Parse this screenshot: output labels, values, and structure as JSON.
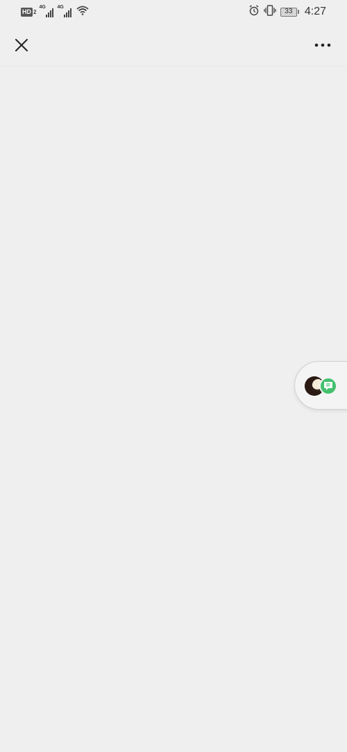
{
  "status_bar": {
    "hd_label": "HD",
    "hd_sub": "2",
    "network_1": "4G",
    "network_2": "4G",
    "battery_level": "33",
    "time": "4:27",
    "icons": [
      "hd-icon",
      "signal-icon",
      "signal-icon",
      "wifi-icon",
      "alarm-icon",
      "vibrate-icon",
      "battery-icon"
    ]
  },
  "top_nav": {
    "close_icon": "close-icon",
    "more_icon": "more-icon"
  },
  "floating_widget": {
    "avatar": "avatar",
    "badge_icon": "chat-bubble-icon",
    "badge_color": "#43c06e"
  },
  "colors": {
    "background": "#efefef",
    "accent": "#43c06e"
  }
}
